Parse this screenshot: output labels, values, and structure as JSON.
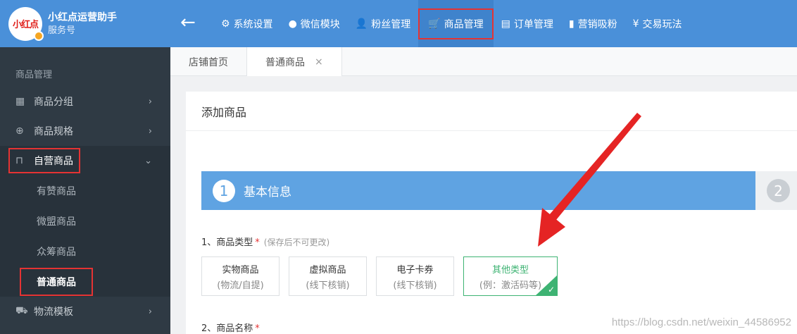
{
  "brand": {
    "logo_text": "小红点",
    "name": "小红点运营助手",
    "type": "服务号"
  },
  "nav": [
    {
      "label": "系统设置",
      "icon": "gear-icon",
      "glyph": "⚙"
    },
    {
      "label": "微信模块",
      "icon": "chat-icon",
      "glyph": "●"
    },
    {
      "label": "粉丝管理",
      "icon": "user-icon",
      "glyph": "👤"
    },
    {
      "label": "商品管理",
      "icon": "cart-icon",
      "glyph": "🛒"
    },
    {
      "label": "订单管理",
      "icon": "document-icon",
      "glyph": "▤"
    },
    {
      "label": "营销吸粉",
      "icon": "bar-chart-icon",
      "glyph": "▮"
    },
    {
      "label": "交易玩法",
      "icon": "coin-icon",
      "glyph": "¥"
    }
  ],
  "sidebar": {
    "heading": "商品管理",
    "items": [
      {
        "label": "商品分组",
        "glyph": "▦"
      },
      {
        "label": "商品规格",
        "glyph": "⊕"
      },
      {
        "label": "自营商品",
        "glyph": "⊓"
      }
    ],
    "sub_items": [
      "有赞商品",
      "微盟商品",
      "众筹商品",
      "普通商品"
    ],
    "last_item": {
      "label": "物流模板",
      "glyph": "⛟"
    }
  },
  "tabs": [
    {
      "label": "店铺首页"
    },
    {
      "label": "普通商品",
      "close": "×"
    }
  ],
  "panel": {
    "title": "添加商品",
    "step1": {
      "num": "1",
      "label": "基本信息"
    },
    "step2": {
      "num": "2"
    },
    "field1": {
      "label": "1、商品类型",
      "req": "*",
      "hint": "(保存后不可更改)"
    },
    "types": [
      {
        "title": "实物商品",
        "sub": "(物流/自提)"
      },
      {
        "title": "虚拟商品",
        "sub": "(线下核销)"
      },
      {
        "title": "电子卡券",
        "sub": "(线下核销)"
      },
      {
        "title": "其他类型",
        "sub": "(例：激活码等)"
      }
    ],
    "field2": {
      "label": "2、商品名称",
      "req": "*"
    }
  },
  "watermark": "https://blog.csdn.net/weixin_44586952"
}
